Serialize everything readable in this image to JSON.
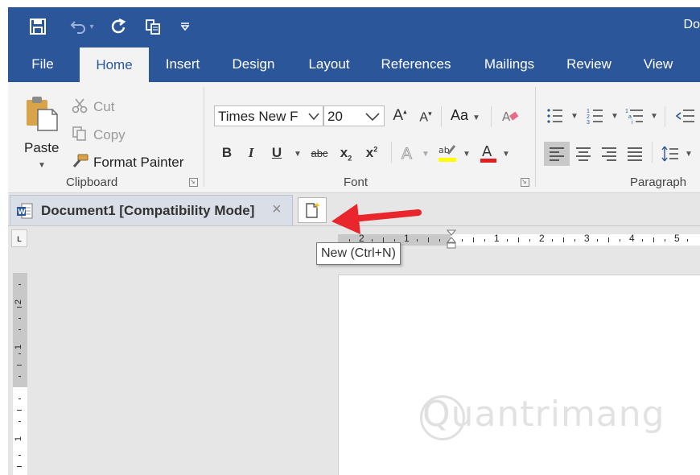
{
  "titlebar": {
    "doc_title": "Do",
    "qat": [
      {
        "name": "save-icon",
        "glyph": "💾"
      },
      {
        "name": "undo-icon",
        "glyph": "↶"
      },
      {
        "name": "redo-icon",
        "glyph": "↻"
      },
      {
        "name": "format-copy-icon",
        "glyph": "⎘"
      },
      {
        "name": "customize-qat-icon",
        "glyph": "⏷"
      }
    ]
  },
  "ribbon_tabs": [
    "File",
    "Home",
    "Insert",
    "Design",
    "Layout",
    "References",
    "Mailings",
    "Review",
    "View"
  ],
  "active_tab": "Home",
  "clipboard": {
    "paste": "Paste",
    "cut": "Cut",
    "copy": "Copy",
    "format_painter": "Format Painter",
    "group_label": "Clipboard"
  },
  "font": {
    "font_name": "Times New F",
    "font_size": "20",
    "change_case": "Aa",
    "group_label": "Font",
    "bold": "B",
    "italic": "I",
    "underline": "U",
    "strike": "abc",
    "subscript": "x",
    "superscript": "x"
  },
  "paragraph": {
    "group_label": "Paragraph"
  },
  "doc_tab": {
    "label": "Document1 [Compatibility Mode]",
    "close": "×"
  },
  "tooltip": "New (Ctrl+N)",
  "ruler": {
    "h_numbers": [
      "2",
      "1",
      "1",
      "2",
      "3",
      "4",
      "5"
    ],
    "v_numbers": [
      "2",
      "1",
      "1"
    ]
  },
  "tab_selector": "L",
  "watermark": "uantrimang",
  "colors": {
    "word_blue": "#2b579a",
    "ribbon_bg": "#f3f3f3",
    "arrow_red": "#e8262b",
    "font_color_bar": "#e02020",
    "highlight_bar": "#ffff00"
  }
}
